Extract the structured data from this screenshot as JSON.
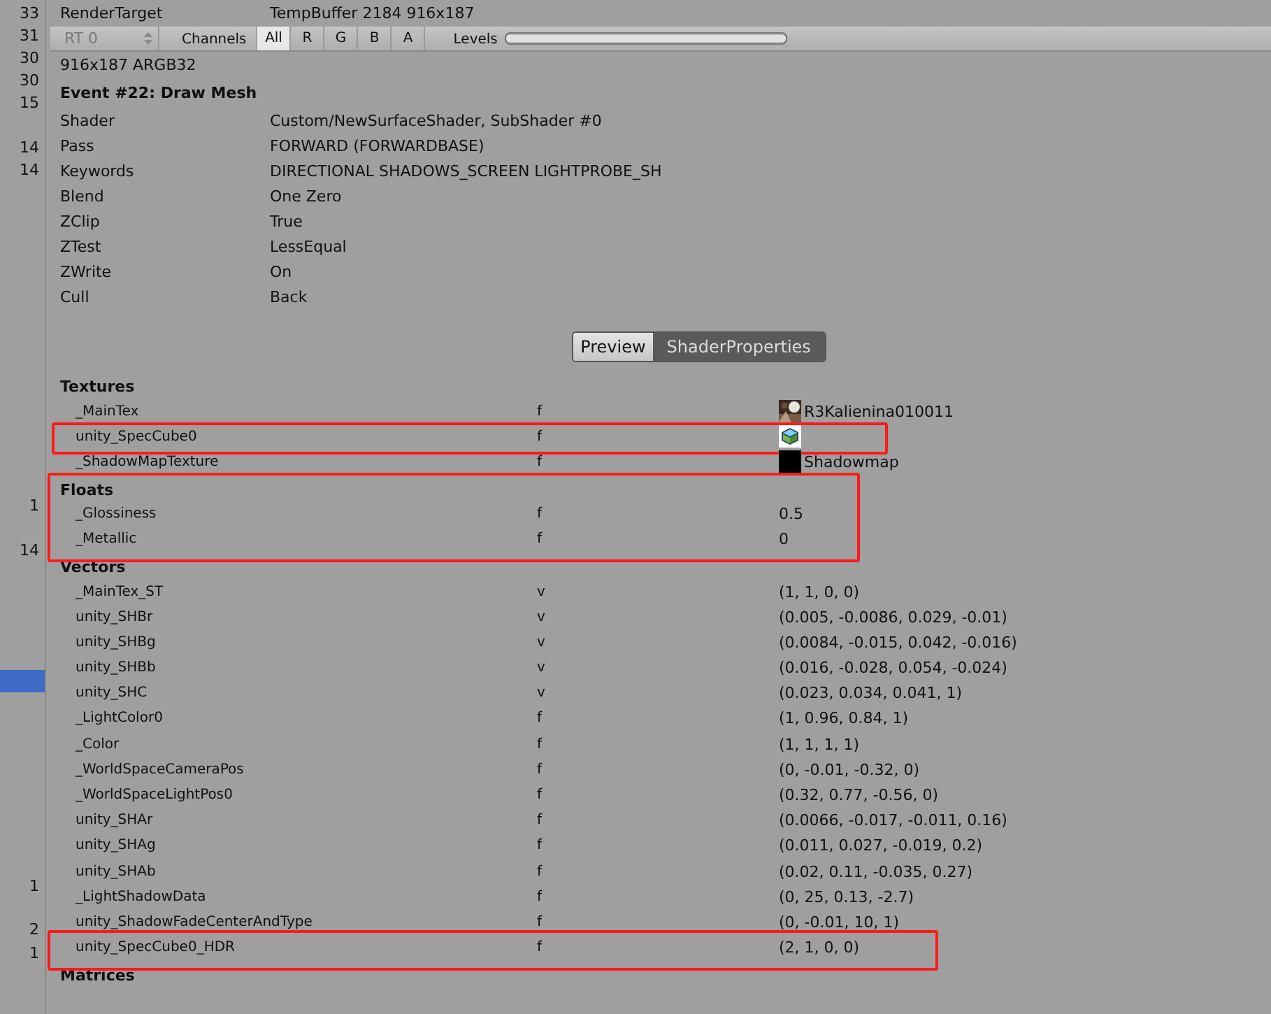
{
  "gutter": [
    {
      "text": "33",
      "selected": false
    },
    {
      "text": "31",
      "selected": false
    },
    {
      "text": "30",
      "selected": false
    },
    {
      "text": "30",
      "selected": false
    },
    {
      "text": "15",
      "selected": false
    },
    {
      "text": "14",
      "selected": false
    },
    {
      "text": "14",
      "selected": false
    },
    {
      "text": "1",
      "selected": false
    },
    {
      "text": "14",
      "selected": false
    },
    {
      "selected": true
    },
    {
      "text": "1",
      "selected": false
    },
    {
      "text": "2",
      "selected": false
    },
    {
      "text": "1",
      "selected": false
    }
  ],
  "render_target": {
    "label": "RenderTarget",
    "value": "TempBuffer 2184 916x187"
  },
  "toolbar": {
    "rt": {
      "value": "RT 0",
      "disabled": true
    },
    "channels_label": "Channels",
    "channels": [
      {
        "label": "All",
        "selected": true
      },
      {
        "label": "R",
        "selected": false
      },
      {
        "label": "G",
        "selected": false
      },
      {
        "label": "B",
        "selected": false
      },
      {
        "label": "A",
        "selected": false
      }
    ],
    "levels_label": "Levels",
    "levels": {
      "level": 1
    }
  },
  "format": "916x187 ARGB32",
  "event_title": "Event #22: Draw Mesh",
  "details": [
    {
      "label": "Shader",
      "value": "Custom/NewSurfaceShader, SubShader #0"
    },
    {
      "label": "Pass",
      "value": "FORWARD (FORWARDBASE)"
    },
    {
      "label": "Keywords",
      "value": "DIRECTIONAL SHADOWS_SCREEN LIGHTPROBE_SH"
    },
    {
      "label": "Blend",
      "value": "One Zero"
    },
    {
      "label": "ZClip",
      "value": "True"
    },
    {
      "label": "ZTest",
      "value": "LessEqual"
    },
    {
      "label": "ZWrite",
      "value": "On"
    },
    {
      "label": "Cull",
      "value": "Back"
    }
  ],
  "view_tabs": [
    {
      "label": "Preview",
      "selected": false
    },
    {
      "label": "ShaderProperties",
      "selected": true
    }
  ],
  "sections": [
    {
      "title": "Textures",
      "boxed": false,
      "rows": [
        {
          "name": "_MainTex",
          "type": "f",
          "value": "R3Kalienina010011",
          "kind": "picture",
          "boxed": false
        },
        {
          "name": "unity_SpecCube0",
          "type": "f",
          "kind": "cube",
          "boxed": true
        },
        {
          "name": "_ShadowMapTexture",
          "type": "f",
          "value": "Shadowmap",
          "kind": "black",
          "boxed": false
        }
      ]
    },
    {
      "title": "Floats",
      "boxed": true,
      "rows": [
        {
          "name": "_Glossiness",
          "type": "f",
          "value": "0.5",
          "boxed": false
        },
        {
          "name": "_Metallic",
          "type": "f",
          "value": "0",
          "boxed": false
        }
      ]
    },
    {
      "title": "Vectors",
      "boxed": false,
      "rows": [
        {
          "name": "_MainTex_ST",
          "type": "v",
          "value": "(1, 1, 0, 0)",
          "boxed": false
        },
        {
          "name": "unity_SHBr",
          "type": "v",
          "value": "(0.005, -0.0086, 0.029, -0.01)",
          "boxed": false
        },
        {
          "name": "unity_SHBg",
          "type": "v",
          "value": "(0.0084, -0.015, 0.042, -0.016)",
          "boxed": false
        },
        {
          "name": "unity_SHBb",
          "type": "v",
          "value": "(0.016, -0.028, 0.054, -0.024)",
          "boxed": false
        },
        {
          "name": "unity_SHC",
          "type": "v",
          "value": "(0.023, 0.034, 0.041, 1)",
          "boxed": false
        },
        {
          "name": "_LightColor0",
          "type": "f",
          "value": "(1, 0.96, 0.84, 1)",
          "boxed": false
        },
        {
          "name": "_Color",
          "type": "f",
          "value": "(1, 1, 1, 1)",
          "boxed": false
        },
        {
          "name": "_WorldSpaceCameraPos",
          "type": "f",
          "value": "(0, -0.01, -0.32, 0)",
          "boxed": false
        },
        {
          "name": "_WorldSpaceLightPos0",
          "type": "f",
          "value": "(0.32, 0.77, -0.56, 0)",
          "boxed": false
        },
        {
          "name": "unity_SHAr",
          "type": "f",
          "value": "(0.0066, -0.017, -0.011, 0.16)",
          "boxed": false
        },
        {
          "name": "unity_SHAg",
          "type": "f",
          "value": "(0.011, 0.027, -0.019, 0.2)",
          "boxed": false
        },
        {
          "name": "unity_SHAb",
          "type": "f",
          "value": "(0.02, 0.11, -0.035, 0.27)",
          "boxed": false
        },
        {
          "name": "_LightShadowData",
          "type": "f",
          "value": "(0, 25, 0.13, -2.7)",
          "boxed": false
        },
        {
          "name": "unity_ShadowFadeCenterAndType",
          "type": "f",
          "value": "(0, -0.01, 10, 1)",
          "boxed": false
        },
        {
          "name": "unity_SpecCube0_HDR",
          "type": "f",
          "value": "(2, 1, 0, 0)",
          "boxed": true
        }
      ]
    },
    {
      "title": "Matrices",
      "boxed": false
    }
  ]
}
